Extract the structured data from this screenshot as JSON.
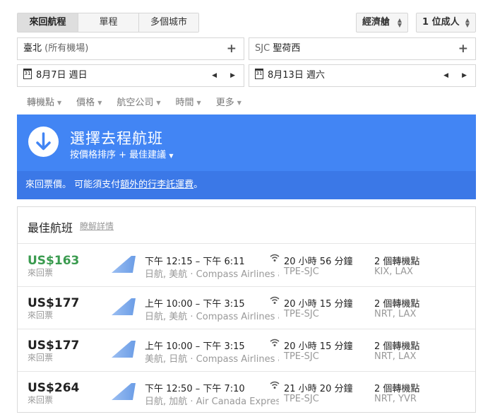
{
  "trip_tabs": [
    "來回航程",
    "單程",
    "多個城市"
  ],
  "cabin": "經濟艙",
  "passengers": "1 位成人",
  "origin": {
    "name": "臺北",
    "detail": "(所有機場)"
  },
  "destination": {
    "code": "SJC",
    "name": "聖荷西"
  },
  "depart_date": "8月7日 週日",
  "return_date": "8月13日 週六",
  "filters": [
    "轉機點",
    "價格",
    "航空公司",
    "時間",
    "更多"
  ],
  "banner": {
    "title": "選擇去程航班",
    "sort": "按價格排序 + 最佳建議",
    "note_prefix": "來回票價。 可能須支付",
    "note_link": "額外的行李託運費",
    "note_suffix": "。"
  },
  "results": {
    "heading": "最佳航班",
    "details_link": "瞭解詳情",
    "flights": [
      {
        "price": "US$163",
        "type": "來回票",
        "time": "下午 12:15 – 下午 6:11",
        "airline": "日航, 美航 · Compass Airlines as",
        "duration": "20 小時 56 分鐘",
        "route": "TPE-SJC",
        "stops": "2 個轉機點",
        "airports": "KIX, LAX"
      },
      {
        "price": "US$177",
        "type": "來回票",
        "time": "上午 10:00 – 下午 3:15",
        "airline": "日航, 美航 · Compass Airlines as",
        "duration": "20 小時 15 分鐘",
        "route": "TPE-SJC",
        "stops": "2 個轉機點",
        "airports": "NRT, LAX"
      },
      {
        "price": "US$177",
        "type": "來回票",
        "time": "上午 10:00 – 下午 3:15",
        "airline": "美航, 日航 · Compass Airlines as",
        "duration": "20 小時 15 分鐘",
        "route": "TPE-SJC",
        "stops": "2 個轉機點",
        "airports": "NRT, LAX"
      },
      {
        "price": "US$264",
        "type": "來回票",
        "time": "下午 12:50 – 下午 7:10",
        "airline": "日航, 加航 · Air Canada Express",
        "duration": "21 小時 20 分鐘",
        "route": "TPE-SJC",
        "stops": "2 個轉機點",
        "airports": "NRT, YVR"
      }
    ]
  },
  "colors": {
    "banner": "#4285f4",
    "banner_dark": "#3b78e7",
    "best_price": "#3a9b4f"
  },
  "icons": [
    "calendar-icon",
    "arrow-down-icon",
    "wifi-icon",
    "airline-logo-icon"
  ]
}
